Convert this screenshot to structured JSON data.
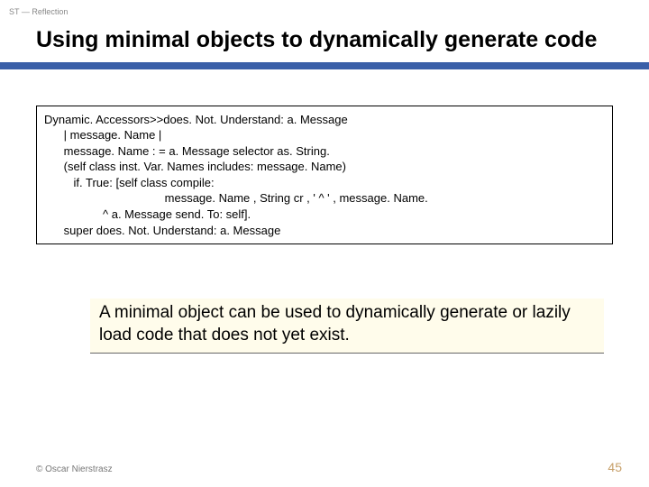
{
  "header": {
    "label": "ST — Reflection"
  },
  "title": "Using minimal objects to dynamically generate code",
  "code": {
    "l1": "Dynamic. Accessors>>does. Not. Understand: a. Message",
    "l2": "      | message. Name |",
    "l3": "      message. Name : = a. Message selector as. String.",
    "l4": "      (self class inst. Var. Names includes: message. Name)",
    "l5": "         if. True: [self class compile:",
    "l6": "                                     message. Name , String cr , ' ^ ' , message. Name.",
    "l7": "                  ^ a. Message send. To: self].",
    "l8": "      super does. Not. Understand: a. Message"
  },
  "callout": "A minimal object can be used to dynamically generate or lazily load code that does not yet exist.",
  "footer": {
    "copyright": "© Oscar Nierstrasz",
    "page": "45"
  }
}
